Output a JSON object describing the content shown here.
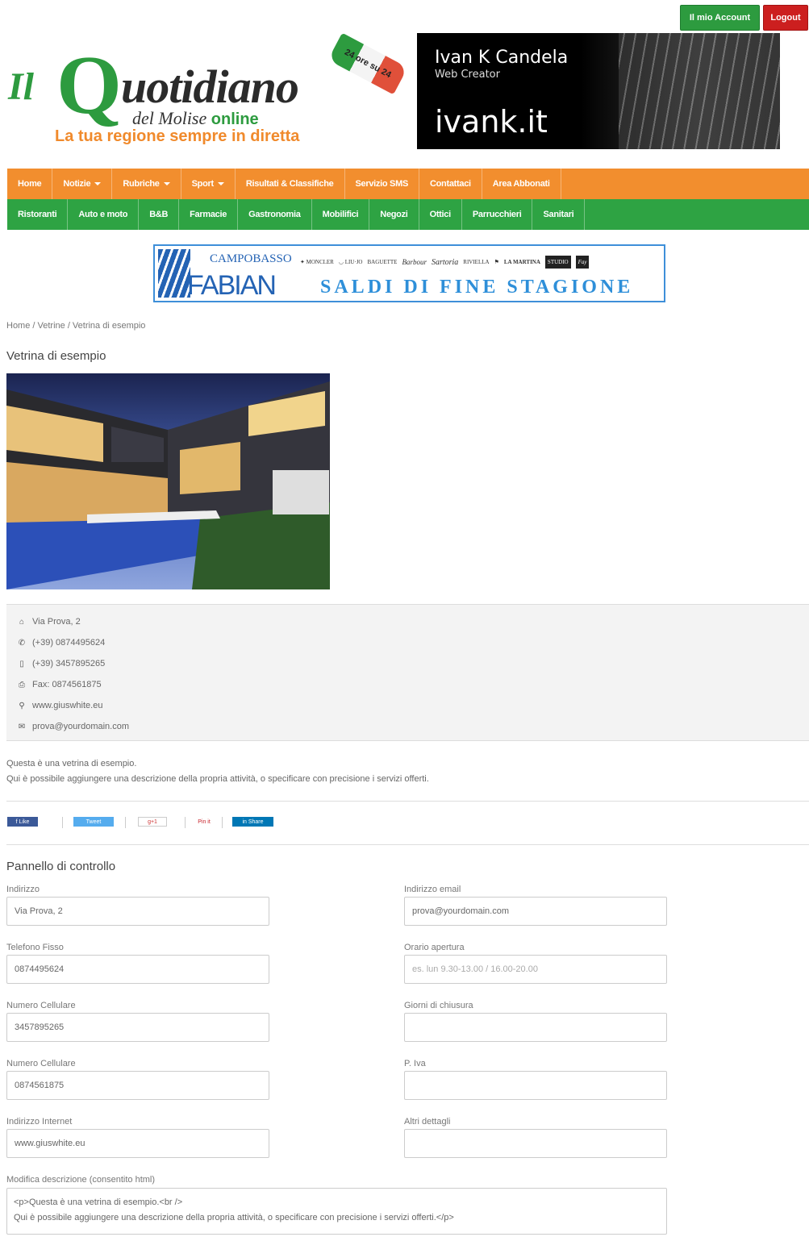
{
  "top": {
    "account": "Il mio Account",
    "logout": "Logout"
  },
  "logo": {
    "il": "Il",
    "q": "Q",
    "rest": "uotidiano",
    "sub": "del Molise",
    "online": "online",
    "ribbon": "24 ore su 24",
    "tagline": "La tua regione sempre in diretta",
    "colors": {
      "green": "#2d9b3f",
      "orange": "#f08a2c"
    }
  },
  "banner": {
    "name": "Ivan K Candela",
    "role": "Web Creator",
    "site": "ivank.it"
  },
  "nav_main": [
    {
      "label": "Home",
      "dropdown": false
    },
    {
      "label": "Notizie",
      "dropdown": true
    },
    {
      "label": "Rubriche",
      "dropdown": true
    },
    {
      "label": "Sport",
      "dropdown": true
    },
    {
      "label": "Risultati & Classifiche",
      "dropdown": false
    },
    {
      "label": "Servizio SMS",
      "dropdown": false
    },
    {
      "label": "Contattaci",
      "dropdown": false
    },
    {
      "label": "Area Abbonati",
      "dropdown": false
    }
  ],
  "nav_cat": [
    "Ristoranti",
    "Auto e moto",
    "B&B",
    "Farmacie",
    "Gastronomia",
    "Mobilifici",
    "Negozi",
    "Ottici",
    "Parrucchieri",
    "Sanitari"
  ],
  "ad": {
    "city": "CAMPOBASSO",
    "brand": "FABIAN",
    "headline": "SALDI DI FINE STAGIONE"
  },
  "breadcrumb": "Home / Vetrine / Vetrina di esempio",
  "title": "Vetrina di esempio",
  "info": {
    "address": "Via Prova, 2",
    "phone": "(+39) 0874495624",
    "mobile": "(+39) 3457895265",
    "fax": "Fax: 0874561875",
    "web": "www.giuswhite.eu",
    "email": "prova@yourdomain.com"
  },
  "description": {
    "line1": "Questa è una vetrina di esempio.",
    "line2": "Qui è possibile aggiungere una descrizione della propria attività, o specificare con precisione i servizi offerti."
  },
  "social": {
    "fb": "f Like",
    "tw": "Tweet",
    "gp": "g+1",
    "pin": "Pin it",
    "li": "in Share"
  },
  "panel": {
    "title": "Pannello di controllo",
    "fields": {
      "indirizzo": {
        "label": "Indirizzo",
        "value": "Via Prova, 2"
      },
      "email": {
        "label": "Indirizzo email",
        "value": "prova@yourdomain.com"
      },
      "telefono": {
        "label": "Telefono Fisso",
        "value": "0874495624"
      },
      "orario": {
        "label": "Orario apertura",
        "placeholder": "es. lun 9.30-13.00 / 16.00-20.00"
      },
      "cellulare": {
        "label": "Numero Cellulare",
        "value": "3457895265"
      },
      "chiusura": {
        "label": "Giorni di chiusura",
        "value": ""
      },
      "cellulare2": {
        "label": "Numero Cellulare",
        "value": "0874561875"
      },
      "piva": {
        "label": "P. Iva",
        "value": ""
      },
      "internet": {
        "label": "Indirizzo Internet",
        "value": "www.giuswhite.eu"
      },
      "altri": {
        "label": "Altri dettagli",
        "value": ""
      }
    },
    "desc_label": "Modifica descrizione (consentito html)",
    "desc_line1": "<p>Questa è una vetrina di esempio.<br />",
    "desc_line2": "Qui è possibile aggiungere una descrizione della propria attività, o specificare con precisione i servizi offerti.</p>"
  }
}
